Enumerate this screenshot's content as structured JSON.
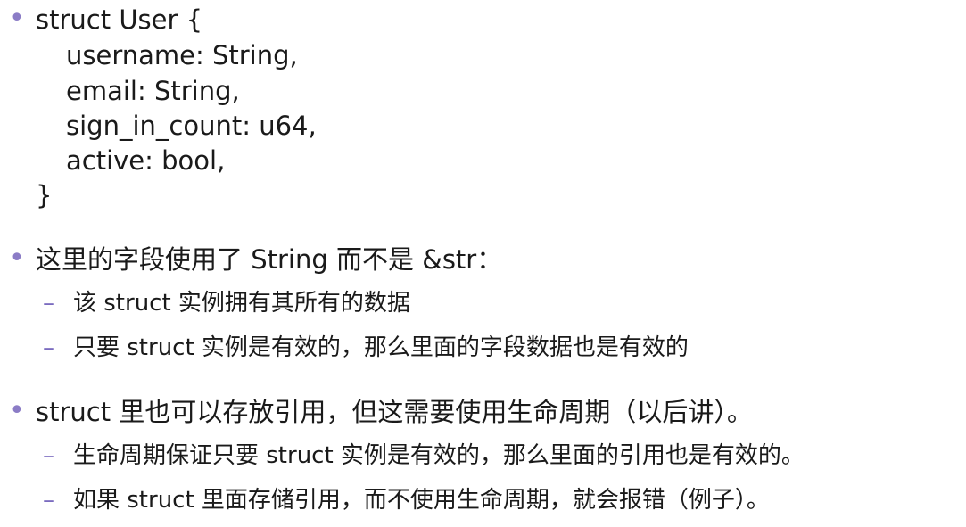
{
  "code_block": {
    "lines": [
      "struct User {",
      "username: String,",
      "email: String,",
      "sign_in_count: u64,",
      "active: bool,",
      "}"
    ]
  },
  "points": [
    {
      "text": "这里的字段使用了 String 而不是 &str：",
      "subpoints": [
        "该 struct 实例拥有其所有的数据",
        "只要 struct 实例是有效的，那么里面的字段数据也是有效的"
      ]
    },
    {
      "text": "struct 里也可以存放引用，但这需要使用生命周期（以后讲）。",
      "subpoints": [
        "生命周期保证只要 struct 实例是有效的，那么里面的引用也是有效的。",
        "如果 struct 里面存储引用，而不使用生命周期，就会报错（例子）。"
      ]
    }
  ],
  "colors": {
    "bullet": "#8b7cc6",
    "dash": "#7a6bbf",
    "text": "#1a1a1a"
  }
}
